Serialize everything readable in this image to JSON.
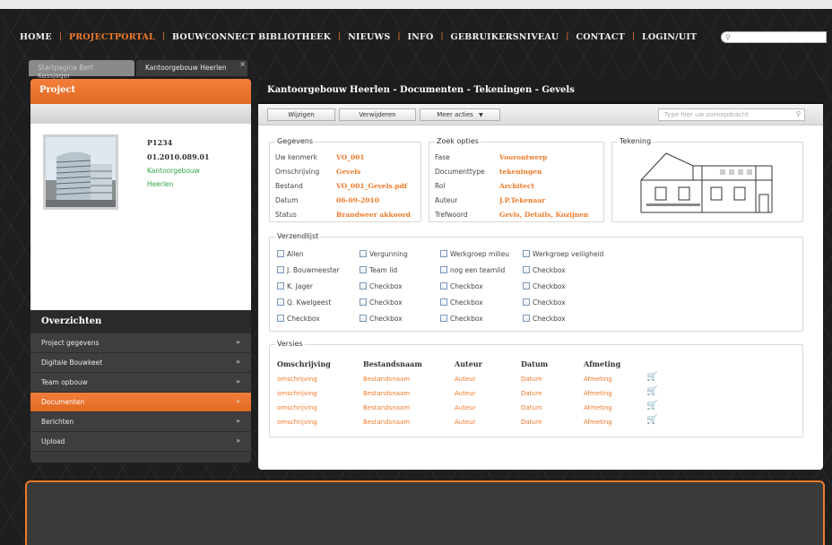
{
  "nav": {
    "items": [
      {
        "label": "HOME",
        "active": false
      },
      {
        "label": "PROJECTPORTAL",
        "active": true
      },
      {
        "label": "BOUWCONNECT BIBLIOTHEEK",
        "active": false
      },
      {
        "label": "NIEUWS",
        "active": false
      },
      {
        "label": "INFO",
        "active": false
      },
      {
        "label": "GEBRUIKERSNIVEAU",
        "active": false
      },
      {
        "label": "CONTACT",
        "active": false
      },
      {
        "label": "LOGIN/UIT",
        "active": false
      }
    ],
    "separator": "|",
    "search_placeholder": ""
  },
  "tabs": [
    {
      "label": "Startpagina Bert Kassjager"
    },
    {
      "label": "Kantoorgebouw Heerlen",
      "close": "×"
    }
  ],
  "project": {
    "title": "Project",
    "code": "P1234",
    "number": "01.2010.089.01",
    "name": "Kantoorgebouw",
    "city": "Heerlen"
  },
  "overzichten": {
    "title": "Overzichten",
    "chevron": "»",
    "items": [
      {
        "label": "Project gegevens"
      },
      {
        "label": "Digitale Bouwkeet"
      },
      {
        "label": "Team opbouw"
      },
      {
        "label": "Documenten",
        "active": true
      },
      {
        "label": "Berichten"
      },
      {
        "label": "Upload"
      }
    ]
  },
  "main": {
    "title": "Kantoorgebouw Heerlen - Documenten - Tekeningen - Gevels",
    "toolbar": {
      "edit": "Wijzigen",
      "delete": "Verwijderen",
      "more": "Meer acties",
      "more_arrow": "▼",
      "search_placeholder": "Type hier uw zoekopdracht"
    },
    "gegevens": {
      "title": "Gegevens",
      "rows": [
        {
          "k": "Uw kenmerk",
          "v": "VO_001"
        },
        {
          "k": "Omschrijving",
          "v": "Gevels"
        },
        {
          "k": "Bestand",
          "v": "VO_001_Gevels.pdf"
        },
        {
          "k": "Datum",
          "v": "06-09-2010"
        },
        {
          "k": "Status",
          "v": "Brandweer akkoord"
        }
      ]
    },
    "zoek": {
      "title": "Zoek opties",
      "rows": [
        {
          "k": "Fase",
          "v": "Voorontwerp"
        },
        {
          "k": "Documenttype",
          "v": "tekeningen"
        },
        {
          "k": "Rol",
          "v": "Architect"
        },
        {
          "k": "Auteur",
          "v": "J.P.Tekenaar"
        },
        {
          "k": "Trefwoord",
          "v": "Gevls, Details, Kozijnen"
        }
      ]
    },
    "tekening": {
      "title": "Tekening"
    },
    "verzendlijst": {
      "title": "Verzendlijst",
      "columns": [
        [
          "Allen",
          "J. Bouwmeester",
          "K. Jager",
          "Q. Kwelgeest",
          "Checkbox"
        ],
        [
          "Vergunning",
          "Team lid",
          "Checkbox",
          "Checkbox",
          "Checkbox"
        ],
        [
          "Werkgroep milieu",
          "nog een teamlid",
          "Checkbox",
          "Checkbox",
          "Checkbox"
        ],
        [
          "Werkgroep veiligheid",
          "Checkbox",
          "Checkbox",
          "Checkbox",
          "Checkbox"
        ]
      ]
    },
    "versies": {
      "title": "Versies",
      "headers": [
        "Omschrijving",
        "Bestandsnaam",
        "Auteur",
        "Datum",
        "Afmeting"
      ],
      "rows": [
        [
          "omschrijving",
          "Bestandsnaam",
          "Auteur",
          "Datum",
          "Afmeting"
        ],
        [
          "omschrijving",
          "Bestandsnaam",
          "Auteur",
          "Datum",
          "Afmeting"
        ],
        [
          "omschrijving",
          "Bestandsnaam",
          "Auteur",
          "Datum",
          "Afmeting"
        ],
        [
          "omschrijving",
          "Bestandsnaam",
          "Auteur",
          "Datum",
          "Afmeting"
        ]
      ]
    }
  },
  "colors": {
    "accent": "#f07a2a",
    "green": "#2ea844",
    "dark": "#1d1d1d"
  }
}
